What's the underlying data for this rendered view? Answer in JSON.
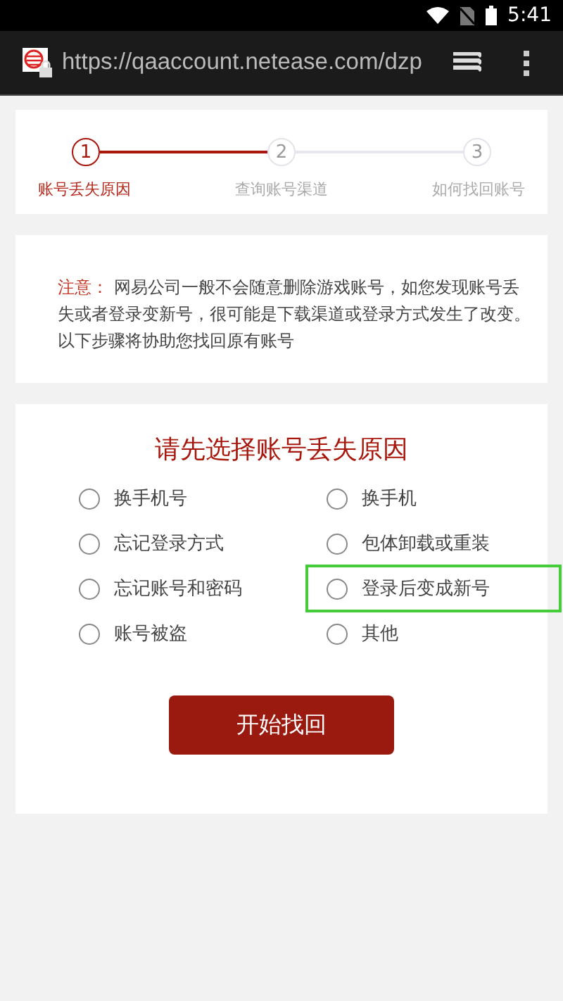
{
  "status_bar": {
    "time": "5:41"
  },
  "browser": {
    "url": "https://qaaccount.netease.com/dzp"
  },
  "progress": {
    "connectors": [
      {
        "done": true
      },
      {
        "done": false
      }
    ],
    "steps": [
      {
        "number": "1",
        "label": "账号丢失原因",
        "selected": true
      },
      {
        "number": "2",
        "label": "查询账号渠道",
        "selected": false
      },
      {
        "number": "3",
        "label": "如何找回账号",
        "selected": false
      }
    ]
  },
  "notice": {
    "label": "注意：",
    "text": "网易公司一般不会随意删除游戏账号，如您发现账号丢失或者登录变新号，很可能是下载渠道或登录方式发生了改变。以下步骤将协助您找回原有账号"
  },
  "form": {
    "title": "请先选择账号丢失原因",
    "options": [
      {
        "label": "换手机号",
        "selected": false,
        "highlighted": false
      },
      {
        "label": "换手机",
        "selected": false,
        "highlighted": false
      },
      {
        "label": "忘记登录方式",
        "selected": false,
        "highlighted": false
      },
      {
        "label": "包体卸载或重装",
        "selected": false,
        "highlighted": false
      },
      {
        "label": "忘记账号和密码",
        "selected": false,
        "highlighted": false
      },
      {
        "label": "登录后变成新号",
        "selected": false,
        "highlighted": true
      },
      {
        "label": "账号被盗",
        "selected": false,
        "highlighted": false
      },
      {
        "label": "其他",
        "selected": false,
        "highlighted": false
      }
    ],
    "button": "开始找回"
  }
}
